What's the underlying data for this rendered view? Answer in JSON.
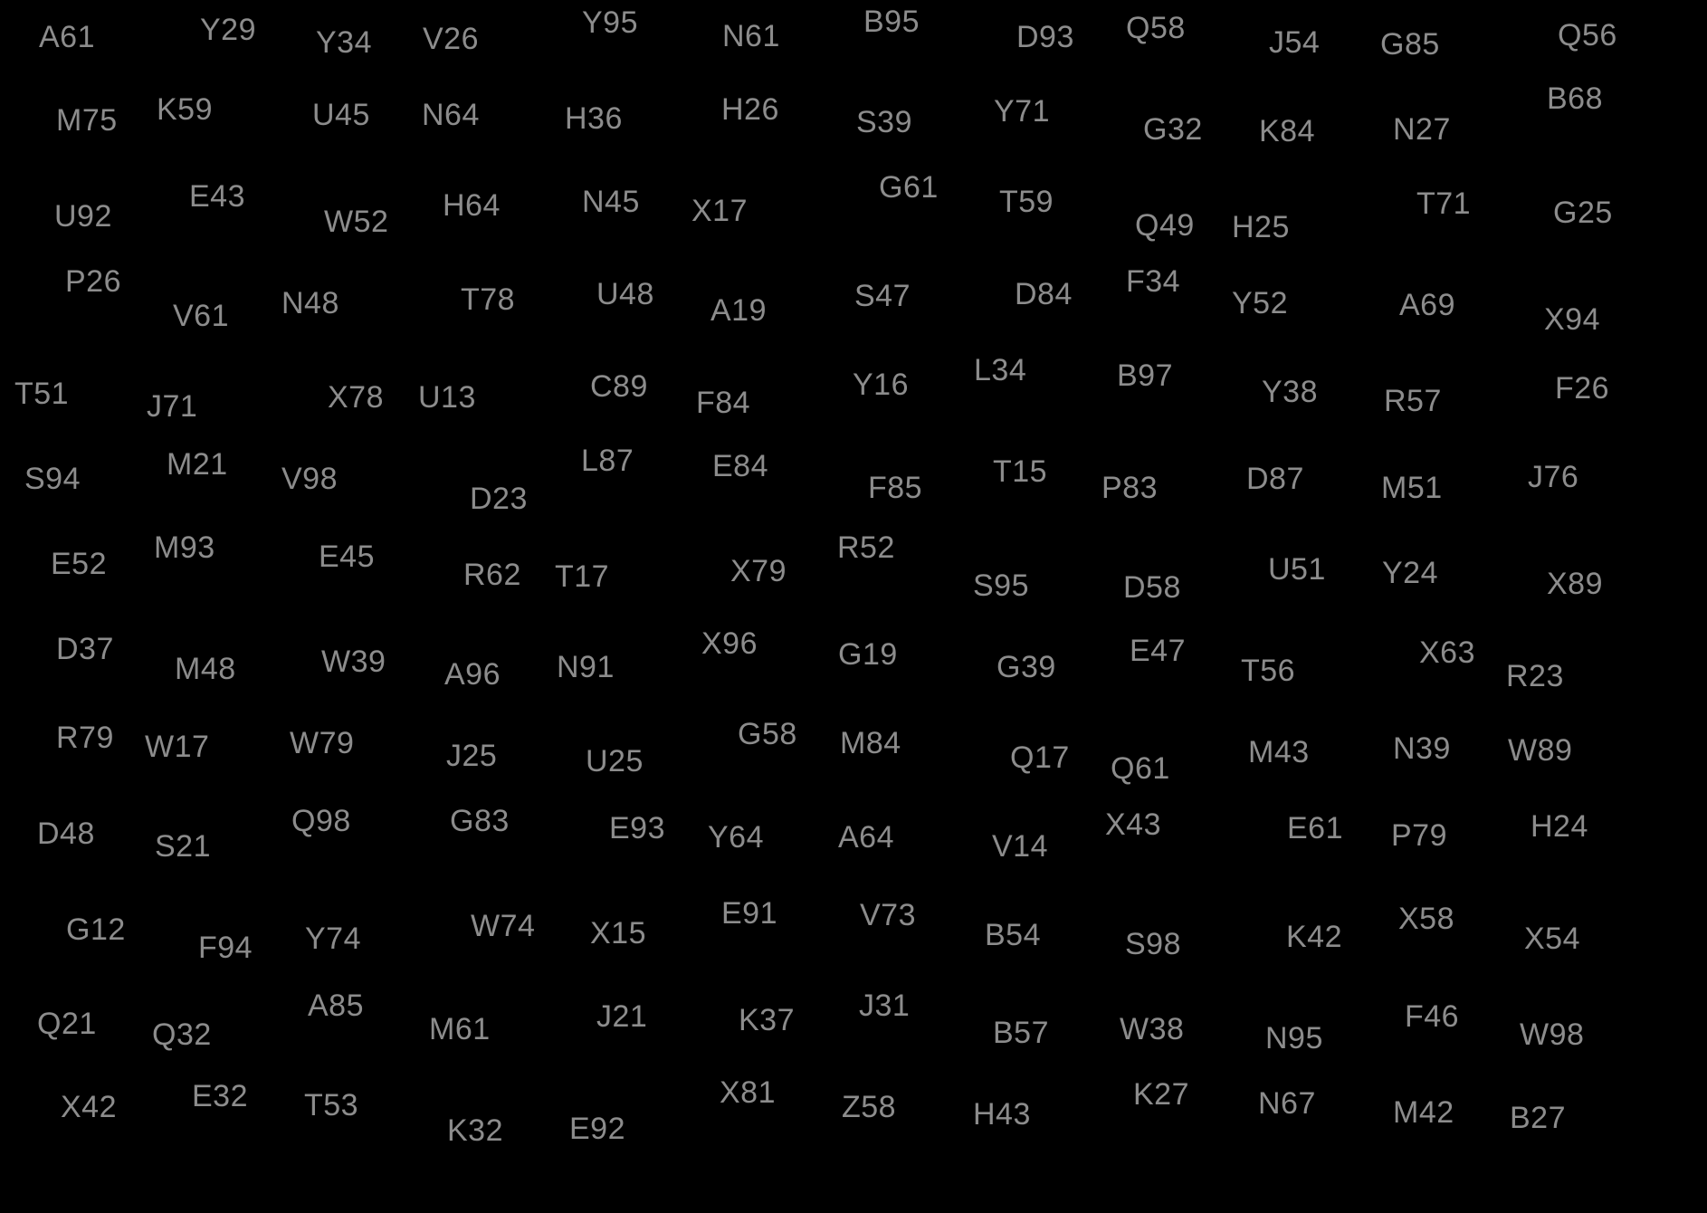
{
  "background_color": "#000000",
  "text_color": "#8c8c8c",
  "rows": [
    [
      "A61",
      "Y29",
      "Y34",
      "V26",
      "Y95",
      "N61",
      "B95",
      "D93",
      "Q58",
      "J54",
      "G85",
      "Q56"
    ],
    [
      "M75",
      "K59",
      "U45",
      "N64",
      "H36",
      "H26",
      "S39",
      "Y71",
      "G32",
      "K84",
      "N27",
      "B68"
    ],
    [
      "U92",
      "E43",
      "W52",
      "H64",
      "N45",
      "X17",
      "G61",
      "T59",
      "Q49",
      "H25",
      "T71",
      "G25"
    ],
    [
      "P26",
      "V61",
      "N48",
      "T78",
      "U48",
      "A19",
      "S47",
      "D84",
      "F34",
      "Y52",
      "A69",
      "X94"
    ],
    [
      "T51",
      "J71",
      "X78",
      "U13",
      "C89",
      "F84",
      "Y16",
      "L34",
      "B97",
      "Y38",
      "R57",
      "F26"
    ],
    [
      "S94",
      "M21",
      "V98",
      "D23",
      "L87",
      "E84",
      "F85",
      "T15",
      "P83",
      "D87",
      "M51",
      "J76"
    ],
    [
      "E52",
      "M93",
      "E45",
      "R62",
      "T17",
      "X79",
      "R52",
      "S95",
      "D58",
      "U51",
      "Y24",
      "X89"
    ],
    [
      "D37",
      "M48",
      "W39",
      "A96",
      "N91",
      "X96",
      "G19",
      "G39",
      "E47",
      "T56",
      "X63",
      "R23"
    ],
    [
      "R79",
      "W17",
      "W79",
      "J25",
      "U25",
      "G58",
      "M84",
      "Q17",
      "Q61",
      "M43",
      "N39",
      "W89"
    ],
    [
      "D48",
      "S21",
      "Q98",
      "G83",
      "E93",
      "Y64",
      "A64",
      "V14",
      "X43",
      "E61",
      "P79",
      "H24"
    ],
    [
      "G12",
      "F94",
      "Y74",
      "W74",
      "X15",
      "E91",
      "V73",
      "B54",
      "S98",
      "K42",
      "X58",
      "X54"
    ],
    [
      "Q21",
      "Q32",
      "A85",
      "M61",
      "J21",
      "K37",
      "J31",
      "B57",
      "W38",
      "N95",
      "F46",
      "W98"
    ],
    [
      "X42",
      "E32",
      "T53",
      "K32",
      "E92",
      "X81",
      "Z58",
      "H43",
      "K27",
      "N67",
      "M42",
      "B27"
    ]
  ]
}
